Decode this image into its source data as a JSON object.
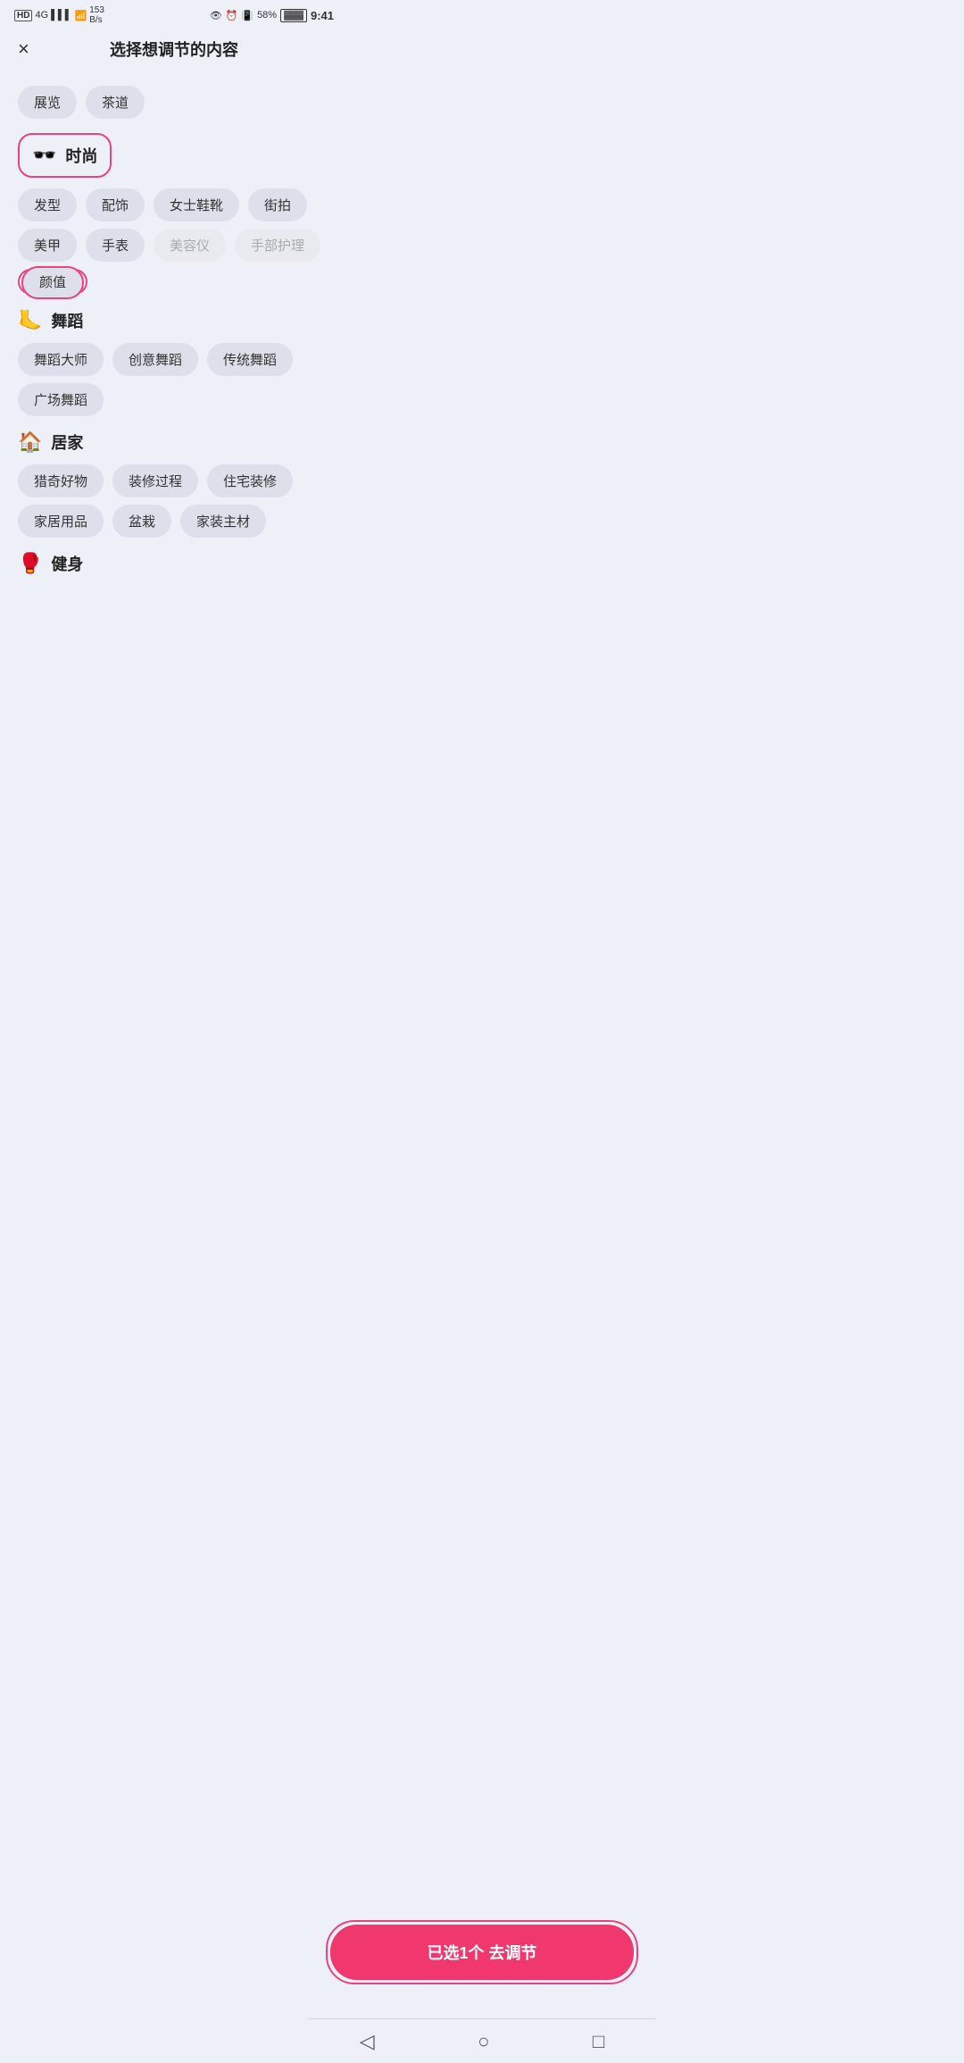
{
  "statusBar": {
    "left": "HD 4G",
    "signal": "📶",
    "wifi": "153 B/s",
    "right_icons": "👁 ⏰ 📳",
    "battery": "58%",
    "time": "9:41"
  },
  "header": {
    "close_label": "×",
    "title": "选择想调节的内容"
  },
  "standalone_tags": [
    {
      "label": "展览",
      "selected": false,
      "disabled": false
    },
    {
      "label": "茶道",
      "selected": false,
      "disabled": false
    }
  ],
  "categories": [
    {
      "id": "fashion",
      "icon": "🕶️",
      "name": "时尚",
      "selected": true,
      "tags": [
        {
          "label": "发型",
          "selected": false,
          "disabled": false
        },
        {
          "label": "配饰",
          "selected": false,
          "disabled": false
        },
        {
          "label": "女士鞋靴",
          "selected": false,
          "disabled": false
        },
        {
          "label": "街拍",
          "selected": false,
          "disabled": false
        },
        {
          "label": "美甲",
          "selected": false,
          "disabled": false
        },
        {
          "label": "手表",
          "selected": false,
          "disabled": false
        },
        {
          "label": "美容仪",
          "selected": false,
          "disabled": true
        },
        {
          "label": "手部护理",
          "selected": false,
          "disabled": true
        }
      ],
      "subtags_selected": [
        {
          "label": "颜值",
          "selected": true
        }
      ]
    },
    {
      "id": "dance",
      "icon": "🦶",
      "name": "舞蹈",
      "selected": false,
      "tags": [
        {
          "label": "舞蹈大师",
          "selected": false,
          "disabled": false
        },
        {
          "label": "创意舞蹈",
          "selected": false,
          "disabled": false
        },
        {
          "label": "传统舞蹈",
          "selected": false,
          "disabled": false
        },
        {
          "label": "广场舞蹈",
          "selected": false,
          "disabled": false
        }
      ],
      "subtags_selected": []
    },
    {
      "id": "home",
      "icon": "🏠",
      "name": "居家",
      "selected": false,
      "tags": [
        {
          "label": "猎奇好物",
          "selected": false,
          "disabled": false
        },
        {
          "label": "装修过程",
          "selected": false,
          "disabled": false
        },
        {
          "label": "住宅装修",
          "selected": false,
          "disabled": false
        },
        {
          "label": "家居用品",
          "selected": false,
          "disabled": false
        },
        {
          "label": "盆栽",
          "selected": false,
          "disabled": false
        },
        {
          "label": "家装主材",
          "selected": false,
          "disabled": false
        }
      ],
      "subtags_selected": []
    },
    {
      "id": "fitness",
      "icon": "🥊",
      "name": "健身",
      "selected": false,
      "tags": [],
      "subtags_selected": []
    }
  ],
  "bottomBtn": {
    "label": "已选1个 去调节"
  },
  "nav": {
    "back": "◁",
    "home": "○",
    "recent": "□"
  }
}
